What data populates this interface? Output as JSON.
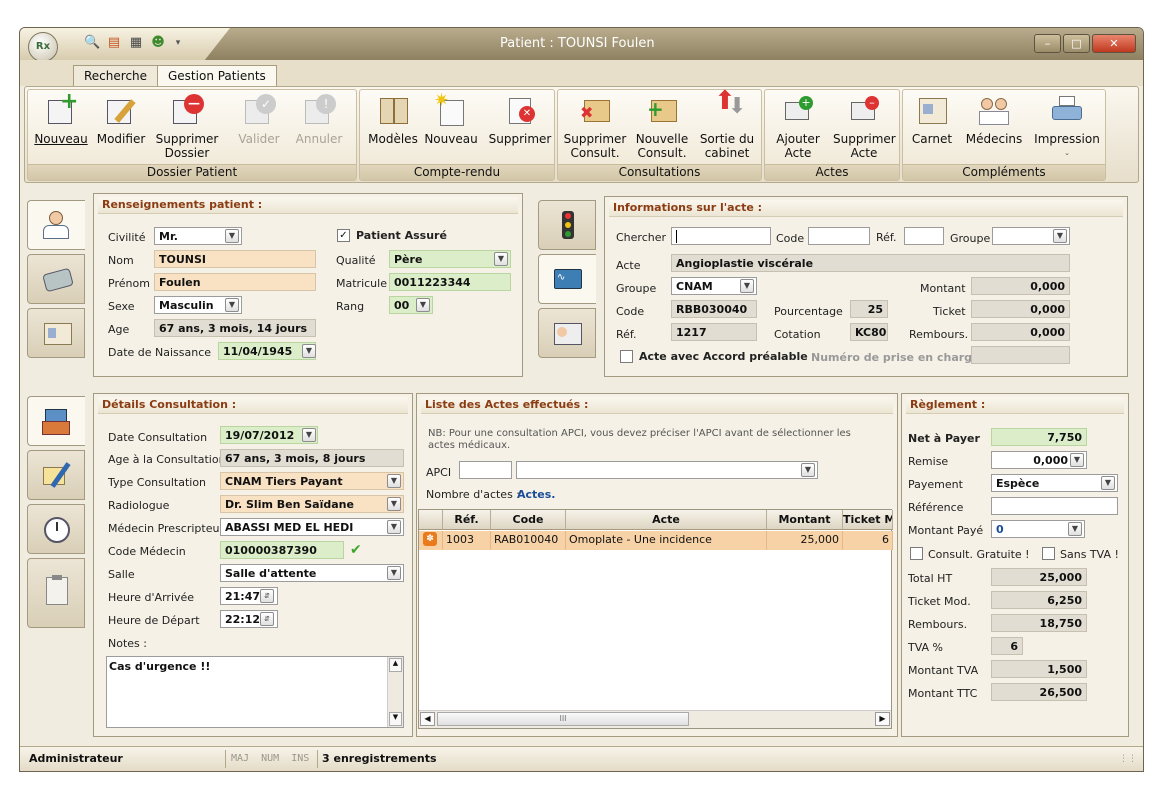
{
  "window": {
    "title": "Patient : TOUNSI  Foulen",
    "app_logo": "Rx"
  },
  "ribbon_tabs": [
    "Recherche",
    "Gestion Patients"
  ],
  "ribbon": {
    "dossier": {
      "label": "Dossier Patient",
      "buttons": [
        "Nouveau",
        "Modifier",
        "Supprimer Dossier",
        "Valider",
        "Annuler"
      ]
    },
    "compte_rendu": {
      "label": "Compte-rendu",
      "buttons": [
        "Modèles",
        "Nouveau",
        "Supprimer"
      ]
    },
    "consultations": {
      "label": "Consultations",
      "buttons": [
        "Supprimer Consult.",
        "Nouvelle Consult.",
        "Sortie du cabinet"
      ]
    },
    "actes": {
      "label": "Actes",
      "buttons": [
        "Ajouter Acte",
        "Supprimer Acte"
      ]
    },
    "complements": {
      "label": "Compléments",
      "buttons": [
        "Carnet",
        "Médecins",
        "Impression"
      ]
    }
  },
  "patient": {
    "title": "Renseignements patient :",
    "civilite_label": "Civilité",
    "civilite": "Mr.",
    "nom_label": "Nom",
    "nom": "TOUNSI",
    "prenom_label": "Prénom",
    "prenom": "Foulen",
    "sexe_label": "Sexe",
    "sexe": "Masculin",
    "age_label": "Age",
    "age": "67 ans, 3 mois, 14 jours",
    "naissance_label": "Date de Naissance",
    "naissance": "11/04/1945",
    "assure_label": "Patient Assuré",
    "assure_checked": "✓",
    "qualite_label": "Qualité",
    "qualite": "Père",
    "matricule_label": "Matricule",
    "matricule": "0011223344",
    "rang_label": "Rang",
    "rang": "00"
  },
  "acte_info": {
    "title": "Informations sur l'acte :",
    "chercher_label": "Chercher",
    "code_label": "Code",
    "ref_label": "Réf.",
    "groupe_label": "Groupe",
    "acte_label": "Acte",
    "acte": "Angioplastie viscérale",
    "groupe2_label": "Groupe",
    "groupe": "CNAM",
    "code2_label": "Code",
    "code": "RBB030040",
    "ref2_label": "Réf.",
    "ref": "1217",
    "pourcentage_label": "Pourcentage",
    "pourcentage": "25",
    "cotation_label": "Cotation",
    "cotation": "KC80",
    "montant_label": "Montant",
    "montant": "0,000",
    "ticket_label": "Ticket",
    "ticket": "0,000",
    "rembours_label": "Rembours.",
    "rembours": "0,000",
    "accord_label": "Acte avec Accord préalable",
    "prise_label": "Numéro de prise en charge"
  },
  "consultation": {
    "title": "Détails Consultation :",
    "date_label": "Date Consultation",
    "date": "19/07/2012",
    "age_label": "Age à la Consultation",
    "age": "67 ans, 3 mois, 8 jours",
    "type_label": "Type Consultation",
    "type": "CNAM Tiers Payant",
    "radiologue_label": "Radiologue",
    "radiologue": "Dr. Slim Ben Saïdane",
    "medecin_label": "Médecin Prescripteur",
    "medecin": "ABASSI MED EL HEDI",
    "code_medecin_label": "Code Médecin",
    "code_medecin": "010000387390",
    "salle_label": "Salle",
    "salle": "Salle d'attente",
    "arrivee_label": "Heure d'Arrivée",
    "arrivee": "21:47",
    "depart_label": "Heure de Départ",
    "depart": "22:12",
    "notes_label": "Notes :",
    "notes": "Cas d'urgence !!"
  },
  "actes_list": {
    "title": "Liste des Actes effectués :",
    "note": "NB: Pour une consultation APCI, vous devez préciser l'APCI avant de sélectionner les actes médicaux.",
    "apci_label": "APCI",
    "nombre_label": "Nombre d'actes :",
    "nombre_value": "Actes.",
    "columns": [
      "Réf.",
      "Code",
      "Acte",
      "Montant",
      "Ticket M"
    ],
    "rows": [
      {
        "ref": "1003",
        "code": "RAB010040",
        "acte": "Omoplate - Une incidence",
        "montant": "25,000",
        "ticket": "6"
      }
    ]
  },
  "reglement": {
    "title": "Règlement :",
    "net_label": "Net à Payer",
    "net": "7,750",
    "remise_label": "Remise",
    "remise": "0,000",
    "payement_label": "Payement",
    "payement": "Espèce",
    "reference_label": "Référence",
    "montant_paye_label": "Montant Payé",
    "montant_paye": "0",
    "gratuite_label": "Consult. Gratuite !",
    "sans_tva_label": "Sans TVA !",
    "total_ht_label": "Total HT",
    "total_ht": "25,000",
    "ticket_label": "Ticket Mod.",
    "ticket": "6,250",
    "rembours_label": "Rembours.",
    "rembours": "18,750",
    "tva_label": "TVA %",
    "tva": "6",
    "montant_tva_label": "Montant TVA",
    "montant_tva": "1,500",
    "ttc_label": "Montant TTC",
    "ttc": "26,500"
  },
  "status": {
    "user": "Administrateur",
    "keys": "MAJ  NUM  INS",
    "records": "3 enregistrements"
  }
}
